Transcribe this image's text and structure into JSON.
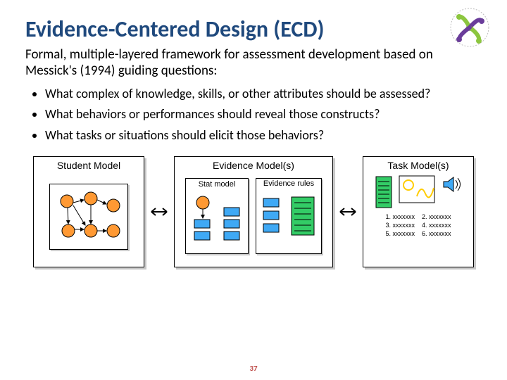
{
  "title": "Evidence-Centered Design (ECD)",
  "intro": "Formal, multiple-layered framework for assessment development based on Messick's (1994) guiding questions:",
  "bullets": [
    "What complex of knowledge, skills, or other attributes should be assessed?",
    "What behaviors or performances should reveal those constructs?",
    "What tasks or situations should elicit those behaviors?"
  ],
  "panels": {
    "student": {
      "title": "Student Model"
    },
    "evidence": {
      "title": "Evidence Model(s)",
      "stat_label": "Stat model",
      "rules_label": "Evidence rules"
    },
    "task": {
      "title": "Task Model(s)",
      "items": {
        "l1": "1. xxxxxxx",
        "l2": "2. xxxxxxx",
        "l3": "3. xxxxxxx",
        "l4": "4. xxxxxxx",
        "l5": "5. xxxxxxx",
        "l6": "6. xxxxxxx"
      }
    }
  },
  "page_number": "37"
}
